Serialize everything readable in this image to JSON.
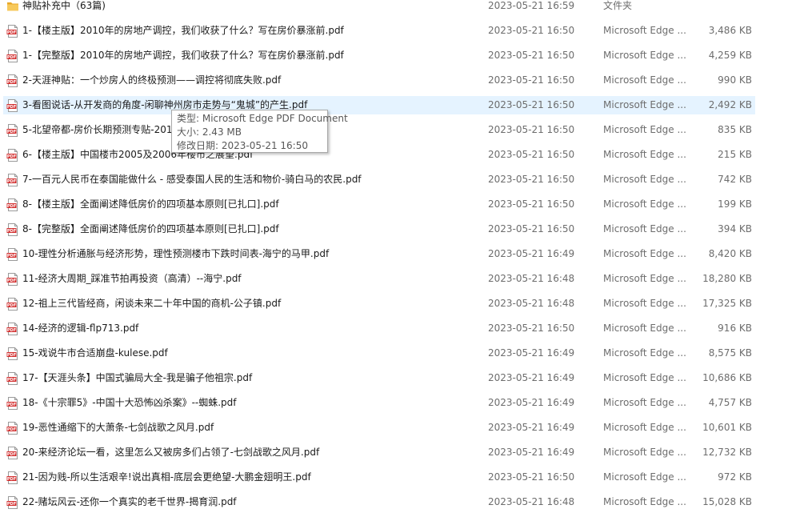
{
  "files": [
    {
      "name": "神贴补充中（63篇)",
      "date": "2023-05-21 16:59",
      "type": "文件夹",
      "size": "",
      "icon": "folder-icon"
    },
    {
      "name": "1-【楼主版】2010年的房地产调控，我们收获了什么？写在房价暴涨前.pdf",
      "date": "2023-05-21 16:50",
      "type": "Microsoft Edge ...",
      "size": "3,486 KB",
      "icon": "pdf-icon"
    },
    {
      "name": "1-【完整版】2010年的房地产调控，我们收获了什么？写在房价暴涨前.pdf",
      "date": "2023-05-21 16:50",
      "type": "Microsoft Edge ...",
      "size": "4,259 KB",
      "icon": "pdf-icon"
    },
    {
      "name": "2-天涯神贴：一个炒房人的终极预测——调控将彻底失败.pdf",
      "date": "2023-05-21 16:50",
      "type": "Microsoft Edge ...",
      "size": "990 KB",
      "icon": "pdf-icon"
    },
    {
      "name": "3-看图说话-从开发商的角度-闲聊神州房市走势与“鬼城”的产生.pdf",
      "date": "2023-05-21 16:50",
      "type": "Microsoft Edge ...",
      "size": "2,492 KB",
      "icon": "pdf-icon"
    },
    {
      "name": "5-北望帝都-房价长期预测专贴-2015年房价回到2007年水平.pdf",
      "date": "2023-05-21 16:50",
      "type": "Microsoft Edge ...",
      "size": "835 KB",
      "icon": "pdf-icon"
    },
    {
      "name": "6-【楼主版】中国楼市2005及2006年楼市之展望.pdf",
      "date": "2023-05-21 16:50",
      "type": "Microsoft Edge ...",
      "size": "215 KB",
      "icon": "pdf-icon"
    },
    {
      "name": "7-一百元人民币在泰国能做什么 - 感受泰国人民的生活和物价-骑白马的农民.pdf",
      "date": "2023-05-21 16:50",
      "type": "Microsoft Edge ...",
      "size": "742 KB",
      "icon": "pdf-icon"
    },
    {
      "name": "8-【楼主版】全面阐述降低房价的四项基本原则[已扎口].pdf",
      "date": "2023-05-21 16:50",
      "type": "Microsoft Edge ...",
      "size": "199 KB",
      "icon": "pdf-icon"
    },
    {
      "name": "8-【完整版】全面阐述降低房价的四项基本原则[已扎口].pdf",
      "date": "2023-05-21 16:50",
      "type": "Microsoft Edge ...",
      "size": "394 KB",
      "icon": "pdf-icon"
    },
    {
      "name": "10-理性分析通胀与经济形势，理性预测楼市下跌时间表-海宁的马甲.pdf",
      "date": "2023-05-21 16:49",
      "type": "Microsoft Edge ...",
      "size": "8,420 KB",
      "icon": "pdf-icon"
    },
    {
      "name": "11-经济大周期_踩准节拍再投资（高清）--海宁.pdf",
      "date": "2023-05-21 16:48",
      "type": "Microsoft Edge ...",
      "size": "18,280 KB",
      "icon": "pdf-icon"
    },
    {
      "name": "12-祖上三代皆经商，闲谈未来二十年中国的商机-公子镇.pdf",
      "date": "2023-05-21 16:48",
      "type": "Microsoft Edge ...",
      "size": "17,325 KB",
      "icon": "pdf-icon"
    },
    {
      "name": "14-经济的逻辑-flp713.pdf",
      "date": "2023-05-21 16:50",
      "type": "Microsoft Edge ...",
      "size": "916 KB",
      "icon": "pdf-icon"
    },
    {
      "name": "15-戏说牛市合适崩盘-kulese.pdf",
      "date": "2023-05-21 16:49",
      "type": "Microsoft Edge ...",
      "size": "8,575 KB",
      "icon": "pdf-icon"
    },
    {
      "name": "17-【天涯头条】中国式骗局大全-我是骗子他祖宗.pdf",
      "date": "2023-05-21 16:49",
      "type": "Microsoft Edge ...",
      "size": "10,686 KB",
      "icon": "pdf-icon"
    },
    {
      "name": "18-《十宗罪5》-中国十大恐怖凶杀案》--蜘蛛.pdf",
      "date": "2023-05-21 16:49",
      "type": "Microsoft Edge ...",
      "size": "4,757 KB",
      "icon": "pdf-icon"
    },
    {
      "name": "19-恶性通缩下的大萧条-七剑战歌之风月.pdf",
      "date": "2023-05-21 16:49",
      "type": "Microsoft Edge ...",
      "size": "10,601 KB",
      "icon": "pdf-icon"
    },
    {
      "name": "20-来经济论坛一看，这里怎么又被房多们占领了-七剑战歌之风月.pdf",
      "date": "2023-05-21 16:49",
      "type": "Microsoft Edge ...",
      "size": "12,732 KB",
      "icon": "pdf-icon"
    },
    {
      "name": "21-因为贱-所以生活艰辛!说出真相-底层会更绝望-大鹏金翅明王.pdf",
      "date": "2023-05-21 16:50",
      "type": "Microsoft Edge ...",
      "size": "972 KB",
      "icon": "pdf-icon"
    },
    {
      "name": "22-赌坛风云-还你一个真实的老千世界-揭育润.pdf",
      "date": "2023-05-21 16:48",
      "type": "Microsoft Edge ...",
      "size": "15,028 KB",
      "icon": "pdf-icon"
    }
  ],
  "hover_index": 4,
  "tooltip": {
    "type_line": "类型: Microsoft Edge PDF Document",
    "size_line": "大小: 2.43 MB",
    "date_line": "修改日期: 2023-05-21 16:50"
  },
  "colors": {
    "hover_background": "#e5f3ff",
    "folder": "#f5c451",
    "pdf_badge": "#d32f2f"
  }
}
